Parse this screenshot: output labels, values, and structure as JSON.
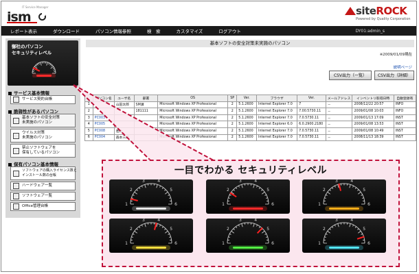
{
  "header": {
    "ism_tag": "IT Service Manager",
    "ism_word": "ism",
    "siterock_word_a": "site",
    "siterock_word_b": "ROCK",
    "siterock_sub": "Powered by Quality Corporation"
  },
  "menu": {
    "items": [
      "レポート表示",
      "ダウンロード",
      "パソコン情報参照",
      "検　索",
      "カスタマイズ",
      "ログアウト"
    ],
    "user": "DY01:admin_s"
  },
  "sidebar": {
    "card_title": "御社のパソコン\nセキュリティレベル",
    "sections": [
      "サービス基本情報",
      "脆弱性があるパソコン",
      "保有パソコン基本情報"
    ],
    "items": [
      "サービス契約台帳",
      "基本ソフトの安全対策\n未実施のパソコン",
      "ウイルス対策\n未実施のパソコン",
      "禁止ソフトウェアを\n保有しているパソコン",
      "ソフトウェアの購入ライセンス数と\nインストール数の台帳",
      "ハードウェア一覧",
      "ソフトウェア一覧",
      "Office管理台帳"
    ]
  },
  "content": {
    "title": "基本ソフトの安全対策未実施のパソコン",
    "date": "※2009/01/09現在",
    "help": "説明ページ",
    "csv_list": "CSV出力（一覧）",
    "csv_detail": "CSV出力（詳細）"
  },
  "table": {
    "headers": [
      "",
      "パソコン名",
      "ユーザ名",
      "部署",
      "OS",
      "SP",
      "Ver.",
      "ブラウザ",
      "Ver.",
      "メールアドレス",
      "インベントリ取得日時",
      "自動登録有"
    ],
    "rows": [
      [
        "1",
        "",
        "山田太郎",
        "SM課",
        "Microsoft Windows XP Professional",
        "2",
        "5.1.2600",
        "Internet Explorer 7.0",
        "7",
        "－",
        "2008/12/22 20:57",
        "INFO"
      ],
      [
        "2",
        "",
        "",
        "181111",
        "Microsoft Windows XP Professional",
        "2",
        "5.1.2600",
        "Internet Explorer 7.0",
        "7.00.5730.11",
        "－",
        "2009/01/08 10:03",
        "INFO"
      ],
      [
        "3",
        "PC003",
        "",
        "",
        "Microsoft Windows XP Professional",
        "2",
        "5.1.2600",
        "Internet Explorer 7.0",
        "7.0.5730.11",
        "－",
        "2009/01/13 17:09",
        "INST"
      ],
      [
        "4",
        "PC005",
        "",
        "",
        "Microsoft Windows XP Professional",
        "2",
        "5.1.2600",
        "Internet Explorer 6.0",
        "6.0.2900.2180",
        "－",
        "2009/01/08 13:53",
        "INST"
      ],
      [
        "5",
        "PC008",
        "若林",
        "",
        "Microsoft Windows XP Professional",
        "2",
        "5.1.2600",
        "Internet Explorer 7.0",
        "7.0.5730.11",
        "－",
        "2009/01/08 10:49",
        "INST"
      ],
      [
        "6",
        "PC004",
        "森本三郎",
        "",
        "Microsoft Windows XP Professional",
        "2",
        "5.1.2600",
        "Internet Explorer 7.0",
        "7.0.5730.11",
        "－",
        "2008/11/13 18:39",
        "INST"
      ]
    ]
  },
  "callout": {
    "title": "一目でわかる セキュリティレベル",
    "gauges": [
      {
        "level": 0.08,
        "glow": "#e8e8e8"
      },
      {
        "level": 0.18,
        "glow": "#ff2a2a"
      },
      {
        "level": 0.42,
        "glow": "#ffae1a"
      },
      {
        "level": 0.58,
        "glow": "#ffe040"
      },
      {
        "level": 0.74,
        "glow": "#55ee44"
      },
      {
        "level": 0.9,
        "glow": "#55e8ff"
      }
    ],
    "sidebar_gauge": {
      "level": 0.15,
      "glow": "#ff2a2a"
    }
  },
  "colors": {
    "accent_red": "#c0103a",
    "menu_bg": "#1a1a1a",
    "link_blue": "#1a50b0"
  }
}
